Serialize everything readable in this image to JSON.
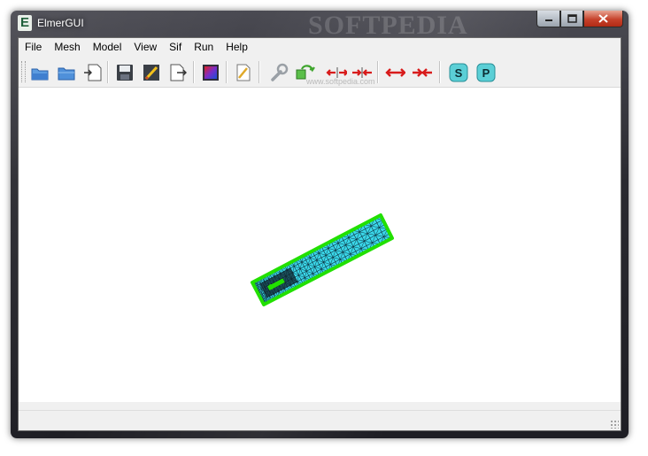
{
  "window": {
    "title": "ElmerGUI",
    "icon": "elmer-e-icon",
    "icon_letter": "E"
  },
  "watermark": "SOFTPEDIA",
  "toolbar_watermark": "www.softpedia.com",
  "menu": [
    "File",
    "Mesh",
    "Model",
    "View",
    "Sif",
    "Run",
    "Help"
  ],
  "toolbar": [
    {
      "name": "open-project-icon"
    },
    {
      "name": "open-file-icon"
    },
    {
      "name": "load-mesh-icon"
    },
    {
      "name": "save-icon"
    },
    {
      "name": "edit-sif-icon"
    },
    {
      "name": "export-icon"
    },
    {
      "name": "colormap-icon"
    },
    {
      "name": "edit-icon"
    },
    {
      "name": "wrench-icon"
    },
    {
      "name": "remesh-icon"
    },
    {
      "name": "divide-surface-icon"
    },
    {
      "name": "unify-surface-icon"
    },
    {
      "name": "divide-edge-icon"
    },
    {
      "name": "unify-edge-icon"
    },
    {
      "name": "start-solver-icon",
      "label": "S",
      "color": "#5bcfd6"
    },
    {
      "name": "start-postprocessor-icon",
      "label": "P",
      "color": "#5bcfd6"
    }
  ],
  "colors": {
    "mesh_fill": "#3ad6e8",
    "mesh_edge": "#0a2a38",
    "boundary": "#22e000",
    "close_button": "#c6422b"
  }
}
